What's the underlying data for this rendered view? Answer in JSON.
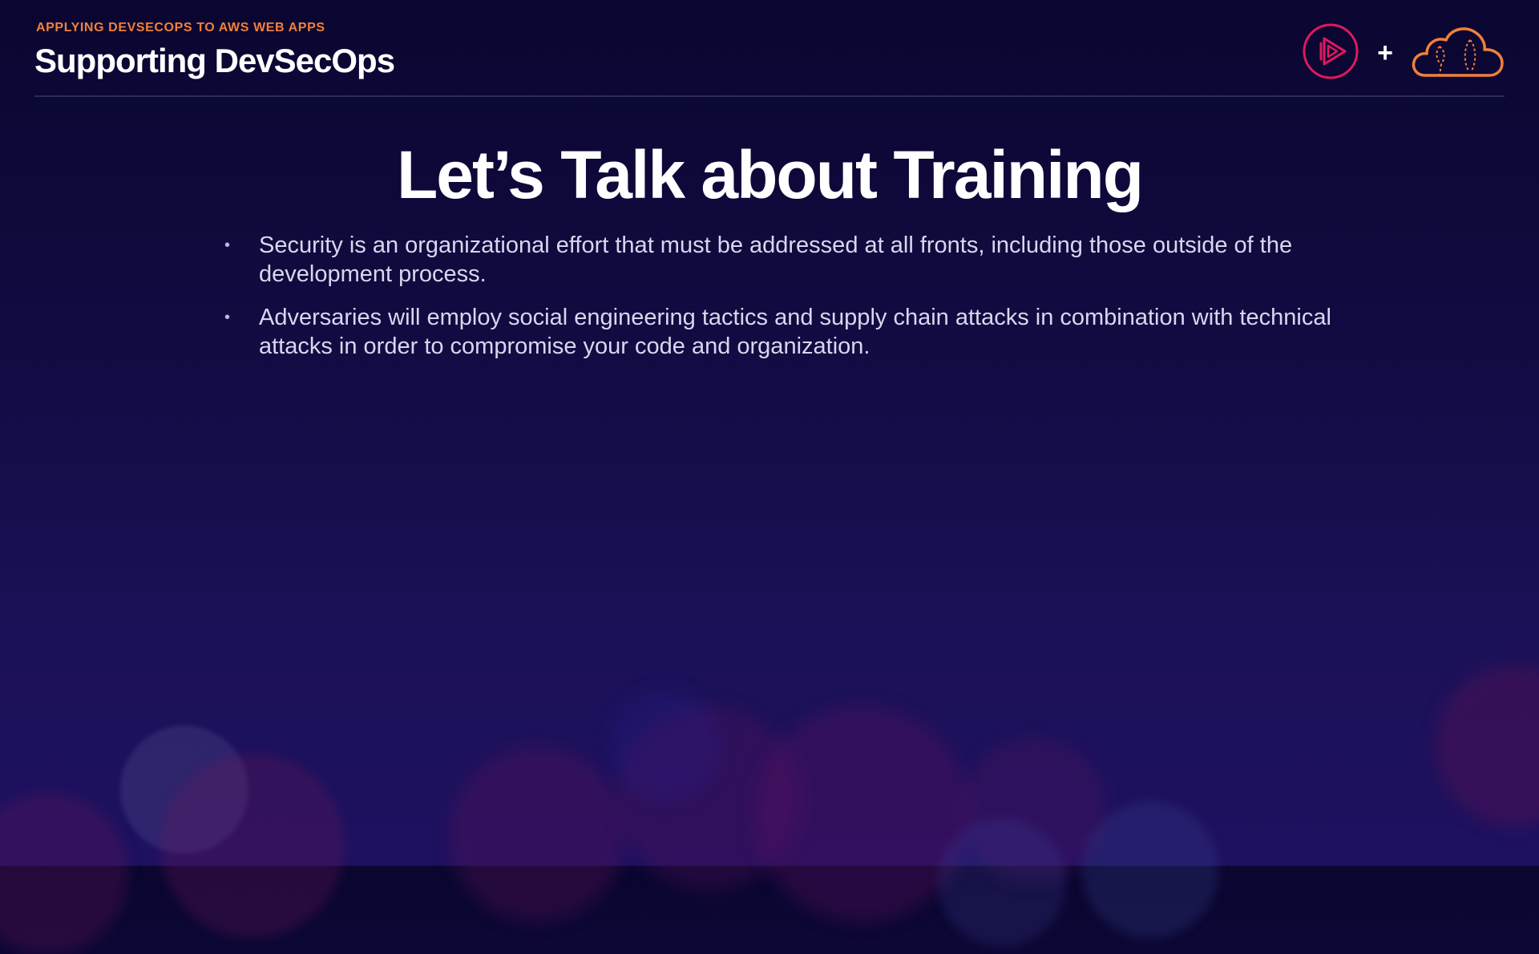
{
  "header": {
    "kicker": "APPLYING DEVSECOPS TO AWS WEB APPS",
    "module_title": "Supporting DevSecOps"
  },
  "logos": {
    "pluralsight_icon": "pluralsight-play-icon",
    "plus_sign": "+",
    "cloud_icon": "aws-cloud-icon",
    "colors": {
      "pluralsight": "#e0185e",
      "cloud": "#f0803a"
    }
  },
  "slide": {
    "title": "Let’s Talk about Training",
    "bullets": [
      {
        "text": "Security is an organizational effort that must be addressed at all fronts, including those outside of the development process."
      },
      {
        "text": "Adversaries will employ social engineering tactics and supply chain attacks in combination with technical attacks in order to compromise your code and organization."
      }
    ]
  },
  "bullet_glyph": "•"
}
